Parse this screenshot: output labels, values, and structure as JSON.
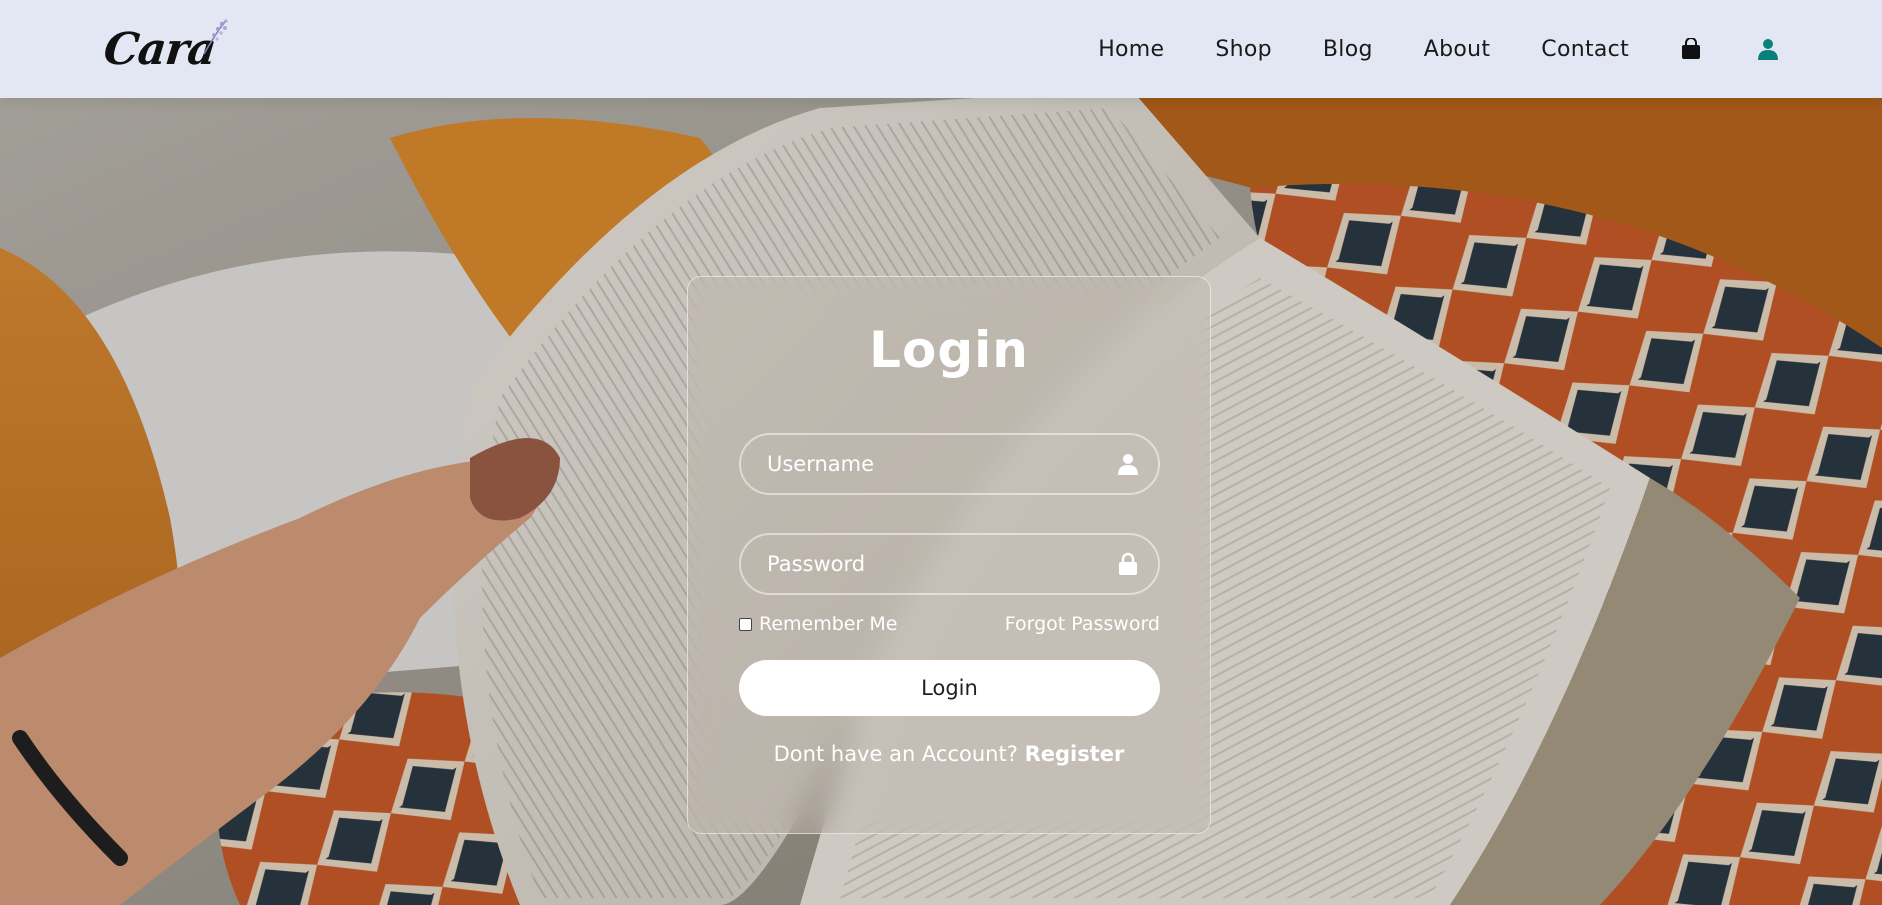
{
  "brand": {
    "logo_text": "Cara"
  },
  "nav": {
    "items": [
      {
        "label": "Home"
      },
      {
        "label": "Shop"
      },
      {
        "label": "Blog"
      },
      {
        "label": "About"
      },
      {
        "label": "Contact"
      }
    ],
    "icons": [
      "shopping-bag-icon",
      "user-icon"
    ],
    "accent_color": "#088178"
  },
  "login": {
    "title": "Login",
    "username_placeholder": "Username",
    "password_placeholder": "Password",
    "remember_label": "Remember Me",
    "forgot_label": "Forgot Password",
    "button_label": "Login",
    "register_prompt": "Dont have an Account?",
    "register_link": "Register"
  },
  "colors": {
    "header_bg": "#e3e6f3",
    "card_text": "#ffffff"
  }
}
